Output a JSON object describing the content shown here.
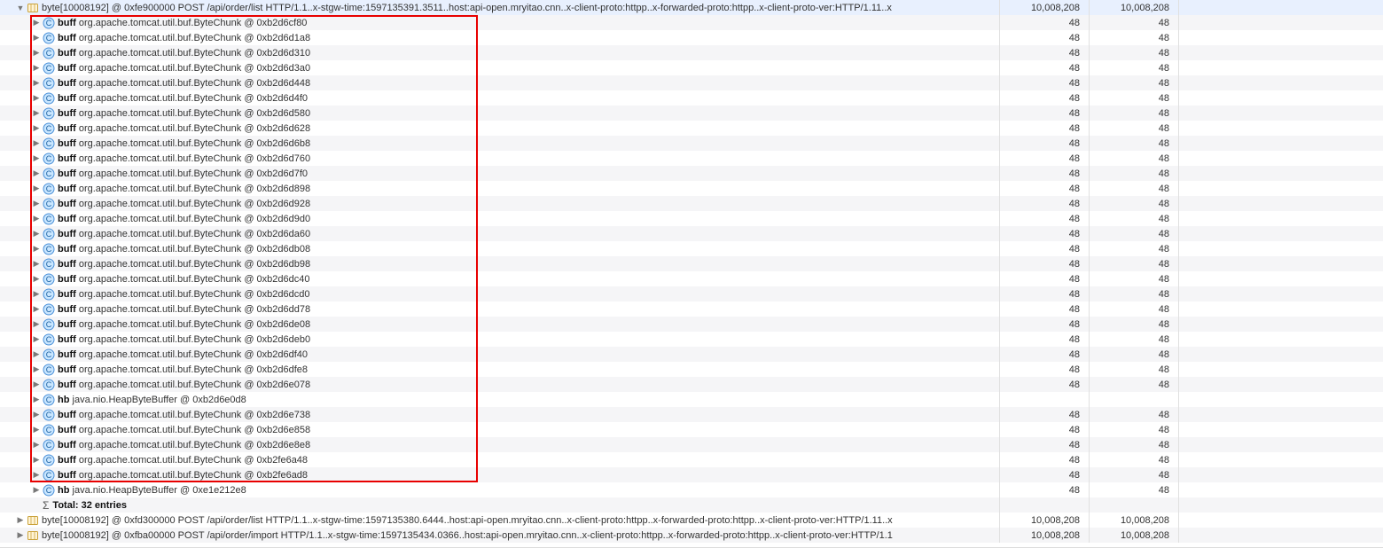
{
  "parent_rows": [
    {
      "text": "byte[10008192] @ 0xfe900000  POST /api/order/list HTTP/1.1..x-stgw-time:1597135391.3511..host:api-open.mryitao.cnn..x-client-proto:httpp..x-forwarded-proto:httpp..x-client-proto-ver:HTTP/1.11..x",
      "v1": "10,008,208",
      "v2": "10,008,208",
      "expanded": true,
      "indent": "indent-1",
      "icon": "array"
    }
  ],
  "children": [
    {
      "field": "buff",
      "cls": "org.apache.tomcat.util.buf.ByteChunk @ 0xb2d6cf80",
      "v1": "48",
      "v2": "48"
    },
    {
      "field": "buff",
      "cls": "org.apache.tomcat.util.buf.ByteChunk @ 0xb2d6d1a8",
      "v1": "48",
      "v2": "48"
    },
    {
      "field": "buff",
      "cls": "org.apache.tomcat.util.buf.ByteChunk @ 0xb2d6d310",
      "v1": "48",
      "v2": "48"
    },
    {
      "field": "buff",
      "cls": "org.apache.tomcat.util.buf.ByteChunk @ 0xb2d6d3a0",
      "v1": "48",
      "v2": "48"
    },
    {
      "field": "buff",
      "cls": "org.apache.tomcat.util.buf.ByteChunk @ 0xb2d6d448",
      "v1": "48",
      "v2": "48"
    },
    {
      "field": "buff",
      "cls": "org.apache.tomcat.util.buf.ByteChunk @ 0xb2d6d4f0",
      "v1": "48",
      "v2": "48"
    },
    {
      "field": "buff",
      "cls": "org.apache.tomcat.util.buf.ByteChunk @ 0xb2d6d580",
      "v1": "48",
      "v2": "48"
    },
    {
      "field": "buff",
      "cls": "org.apache.tomcat.util.buf.ByteChunk @ 0xb2d6d628",
      "v1": "48",
      "v2": "48"
    },
    {
      "field": "buff",
      "cls": "org.apache.tomcat.util.buf.ByteChunk @ 0xb2d6d6b8",
      "v1": "48",
      "v2": "48"
    },
    {
      "field": "buff",
      "cls": "org.apache.tomcat.util.buf.ByteChunk @ 0xb2d6d760",
      "v1": "48",
      "v2": "48"
    },
    {
      "field": "buff",
      "cls": "org.apache.tomcat.util.buf.ByteChunk @ 0xb2d6d7f0",
      "v1": "48",
      "v2": "48"
    },
    {
      "field": "buff",
      "cls": "org.apache.tomcat.util.buf.ByteChunk @ 0xb2d6d898",
      "v1": "48",
      "v2": "48"
    },
    {
      "field": "buff",
      "cls": "org.apache.tomcat.util.buf.ByteChunk @ 0xb2d6d928",
      "v1": "48",
      "v2": "48"
    },
    {
      "field": "buff",
      "cls": "org.apache.tomcat.util.buf.ByteChunk @ 0xb2d6d9d0",
      "v1": "48",
      "v2": "48"
    },
    {
      "field": "buff",
      "cls": "org.apache.tomcat.util.buf.ByteChunk @ 0xb2d6da60",
      "v1": "48",
      "v2": "48"
    },
    {
      "field": "buff",
      "cls": "org.apache.tomcat.util.buf.ByteChunk @ 0xb2d6db08",
      "v1": "48",
      "v2": "48"
    },
    {
      "field": "buff",
      "cls": "org.apache.tomcat.util.buf.ByteChunk @ 0xb2d6db98",
      "v1": "48",
      "v2": "48"
    },
    {
      "field": "buff",
      "cls": "org.apache.tomcat.util.buf.ByteChunk @ 0xb2d6dc40",
      "v1": "48",
      "v2": "48"
    },
    {
      "field": "buff",
      "cls": "org.apache.tomcat.util.buf.ByteChunk @ 0xb2d6dcd0",
      "v1": "48",
      "v2": "48"
    },
    {
      "field": "buff",
      "cls": "org.apache.tomcat.util.buf.ByteChunk @ 0xb2d6dd78",
      "v1": "48",
      "v2": "48"
    },
    {
      "field": "buff",
      "cls": "org.apache.tomcat.util.buf.ByteChunk @ 0xb2d6de08",
      "v1": "48",
      "v2": "48"
    },
    {
      "field": "buff",
      "cls": "org.apache.tomcat.util.buf.ByteChunk @ 0xb2d6deb0",
      "v1": "48",
      "v2": "48"
    },
    {
      "field": "buff",
      "cls": "org.apache.tomcat.util.buf.ByteChunk @ 0xb2d6df40",
      "v1": "48",
      "v2": "48"
    },
    {
      "field": "buff",
      "cls": "org.apache.tomcat.util.buf.ByteChunk @ 0xb2d6dfe8",
      "v1": "48",
      "v2": "48"
    },
    {
      "field": "buff",
      "cls": "org.apache.tomcat.util.buf.ByteChunk @ 0xb2d6e078",
      "v1": "48",
      "v2": "48"
    },
    {
      "field": "hb",
      "cls": "java.nio.HeapByteBuffer @ 0xb2d6e0d8",
      "v1": "",
      "v2": ""
    },
    {
      "field": "buff",
      "cls": "org.apache.tomcat.util.buf.ByteChunk @ 0xb2d6e738",
      "v1": "48",
      "v2": "48"
    },
    {
      "field": "buff",
      "cls": "org.apache.tomcat.util.buf.ByteChunk @ 0xb2d6e858",
      "v1": "48",
      "v2": "48"
    },
    {
      "field": "buff",
      "cls": "org.apache.tomcat.util.buf.ByteChunk @ 0xb2d6e8e8",
      "v1": "48",
      "v2": "48"
    },
    {
      "field": "buff",
      "cls": "org.apache.tomcat.util.buf.ByteChunk @ 0xb2fe6a48",
      "v1": "48",
      "v2": "48"
    },
    {
      "field": "buff",
      "cls": "org.apache.tomcat.util.buf.ByteChunk @ 0xb2fe6ad8",
      "v1": "48",
      "v2": "48"
    },
    {
      "field": "hb",
      "cls": "java.nio.HeapByteBuffer @ 0xe1e212e8",
      "v1": "48",
      "v2": "48"
    }
  ],
  "totals_label": "Total: 32 entries",
  "tail_rows": [
    {
      "text": "byte[10008192] @ 0xfd300000  POST /api/order/list HTTP/1.1..x-stgw-time:1597135380.6444..host:api-open.mryitao.cnn..x-client-proto:httpp..x-forwarded-proto:httpp..x-client-proto-ver:HTTP/1.11..x",
      "v1": "10,008,208",
      "v2": "10,008,208"
    },
    {
      "text": "byte[10008192] @ 0xfba00000  POST /api/order/import HTTP/1.1..x-stgw-time:1597135434.0366..host:api-open.mryitao.cnn..x-client-proto:httpp..x-forwarded-proto:httpp..x-client-proto-ver:HTTP/1.1",
      "v1": "10,008,208",
      "v2": "10,008,208"
    }
  ]
}
